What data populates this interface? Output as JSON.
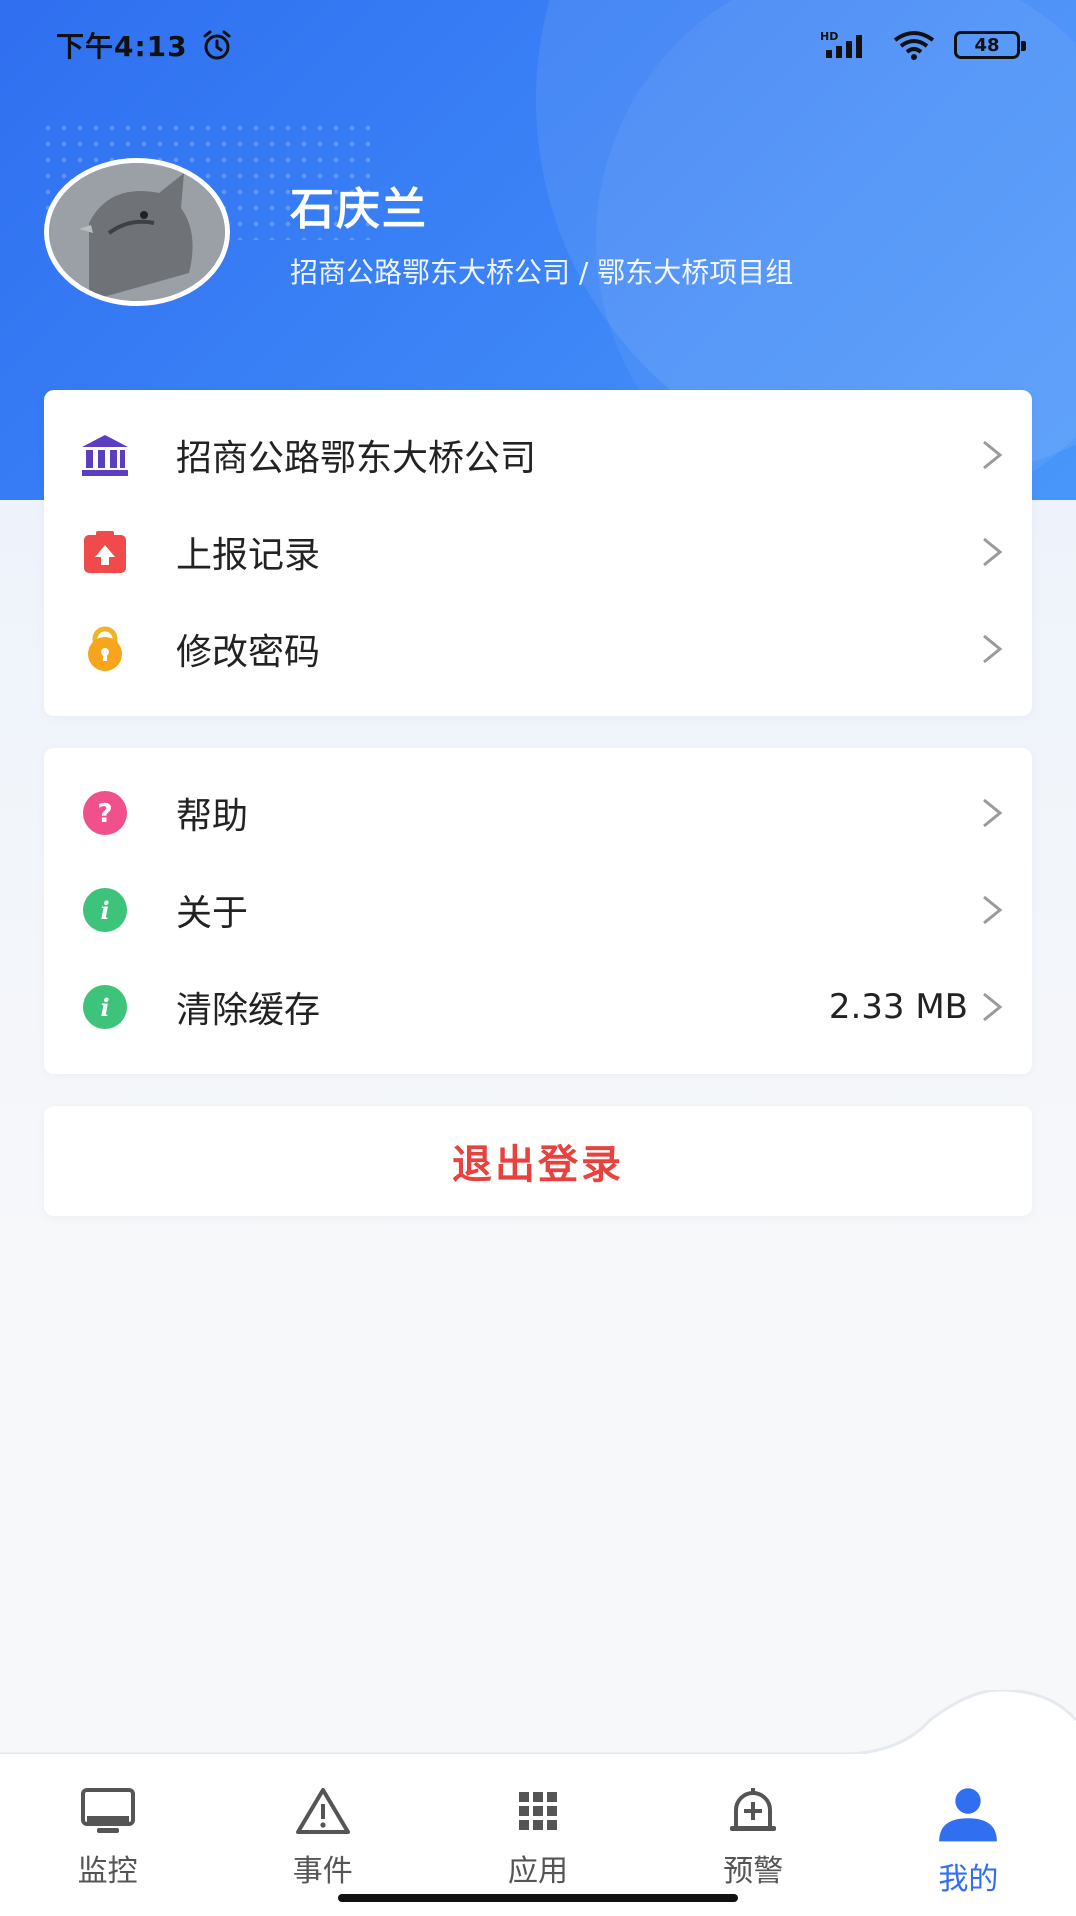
{
  "status_bar": {
    "time": "下午4:13",
    "network_label": "HD",
    "battery": "48"
  },
  "profile": {
    "name": "石庆兰",
    "org_path": "招商公路鄂东大桥公司 / 鄂东大桥项目组"
  },
  "menu_group_1": [
    {
      "label": "招商公路鄂东大桥公司",
      "icon": "bank-icon",
      "color": "#5b3fc0"
    },
    {
      "label": "上报记录",
      "icon": "upload-clipboard-icon",
      "color": "#f04a4a"
    },
    {
      "label": "修改密码",
      "icon": "lock-icon",
      "color": "#f6a51c"
    }
  ],
  "menu_group_2": [
    {
      "label": "帮助",
      "icon": "help-icon",
      "color": "#f0508c"
    },
    {
      "label": "关于",
      "icon": "info-icon",
      "color": "#3dc47a"
    },
    {
      "label": "清除缓存",
      "icon": "info-icon",
      "color": "#3dc47a",
      "value": "2.33 MB"
    }
  ],
  "logout": {
    "label": "退出登录",
    "color": "#e8423f"
  },
  "bottom_nav": [
    {
      "label": "监控",
      "icon": "monitor-icon",
      "active": false
    },
    {
      "label": "事件",
      "icon": "warning-icon",
      "active": false
    },
    {
      "label": "应用",
      "icon": "grid-icon",
      "active": false
    },
    {
      "label": "预警",
      "icon": "alarm-bell-icon",
      "active": false
    },
    {
      "label": "我的",
      "icon": "user-icon",
      "active": true
    }
  ],
  "colors": {
    "primary": "#2f6ff0",
    "danger": "#e8423f"
  }
}
